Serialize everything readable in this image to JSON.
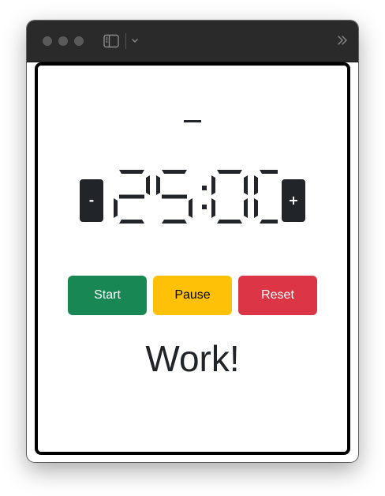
{
  "timer": {
    "display": "25:00",
    "minus_label": "-",
    "plus_label": "+"
  },
  "controls": {
    "start_label": "Start",
    "pause_label": "Pause",
    "reset_label": "Reset"
  },
  "status": {
    "mode_text": "Work!"
  },
  "icons": {
    "sidebar": "sidebar-toggle-icon",
    "chevron": "chevron-down-icon",
    "more": "double-chevron-right-icon"
  },
  "colors": {
    "start": "#198754",
    "pause": "#ffc107",
    "reset": "#dc3545",
    "dark": "#212529"
  }
}
